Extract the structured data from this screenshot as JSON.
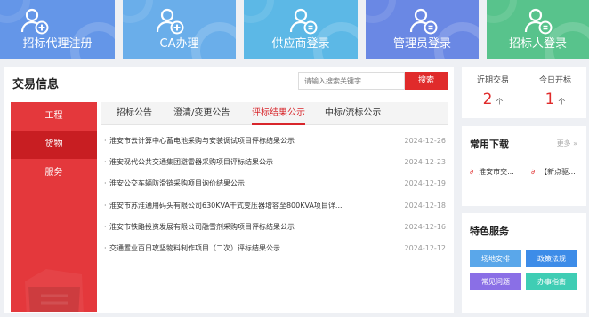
{
  "tiles": [
    {
      "label": "招标代理注册",
      "color": "#6496e8",
      "icon": "user-add-icon"
    },
    {
      "label": "CA办理",
      "color": "#6aaeea",
      "icon": "user-add-icon"
    },
    {
      "label": "供应商登录",
      "color": "#5cb8e6",
      "icon": "user-badge-icon"
    },
    {
      "label": "管理员登录",
      "color": "#6a88e4",
      "icon": "user-badge-icon"
    },
    {
      "label": "招标人登录",
      "color": "#58c38c",
      "icon": "user-badge-icon"
    }
  ],
  "main": {
    "title": "交易信息",
    "search_placeholder": "请输入搜索关键字",
    "search_button": "搜索",
    "side_menu": [
      "工程",
      "货物",
      "服务"
    ],
    "active_side": "货物",
    "tabs": [
      "招标公告",
      "澄清/变更公告",
      "评标结果公示",
      "中标/流标公示"
    ],
    "active_tab": "评标结果公示",
    "rows": [
      {
        "title": "淮安市云计算中心蓄电池采购与安装调试项目评标结果公示",
        "date": "2024-12-26"
      },
      {
        "title": "淮安现代公共交通集团避雷器采购项目评标结果公示",
        "date": "2024-12-23"
      },
      {
        "title": "淮安公交车辆防滑链采购项目询价结果公示",
        "date": "2024-12-19"
      },
      {
        "title": "淮安市苏淮通用码头有限公司630KVA干式变压器增容至800KVA项目详...",
        "date": "2024-12-18"
      },
      {
        "title": "淮安市铁路投资发展有限公司融雪剂采购项目评标结果公示",
        "date": "2024-12-16"
      },
      {
        "title": "交通置业百日攻坚物料制作项目（二次）评标结果公示",
        "date": "2024-12-12"
      }
    ]
  },
  "stats": {
    "recent": {
      "label": "近期交易",
      "value": "2",
      "unit": "个"
    },
    "today": {
      "label": "今日开标",
      "value": "1",
      "unit": "个"
    }
  },
  "downloads": {
    "title": "常用下载",
    "more": "更多 »",
    "items": [
      "淮安市交...",
      "【新点驱..."
    ]
  },
  "services": {
    "title": "特色服务",
    "buttons": [
      {
        "label": "场地安排",
        "color": "#5aa7ea"
      },
      {
        "label": "政策法规",
        "color": "#3d8ce8"
      },
      {
        "label": "常见问题",
        "color": "#8a6fe6"
      },
      {
        "label": "办事指南",
        "color": "#3fcdb4"
      }
    ]
  }
}
